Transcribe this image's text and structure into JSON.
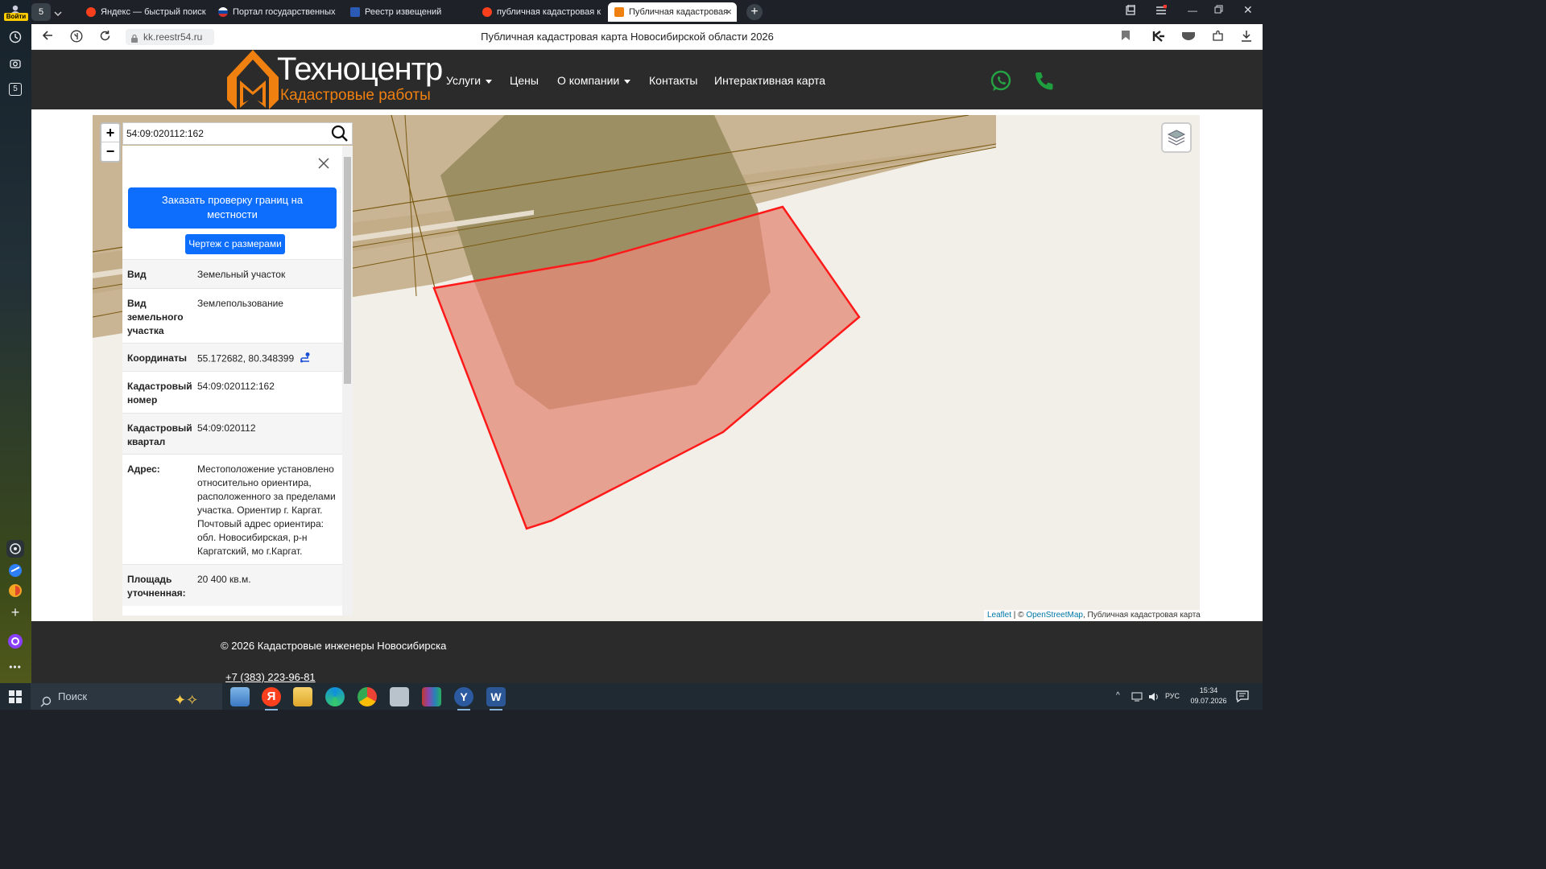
{
  "browser": {
    "login_label": "Войти",
    "tab_counter": "5",
    "tabs": [
      {
        "label": "Яндекс — быстрый поиск",
        "active": false
      },
      {
        "label": "Портал государственных",
        "active": false
      },
      {
        "label": "Реестр извещений",
        "active": false
      },
      {
        "label": "публичная кадастровая к",
        "active": false
      },
      {
        "label": "Публичная кадастровая",
        "active": true
      }
    ],
    "url": "kk.reestr54.ru",
    "page_title": "Публичная кадастровая карта Новосибирской области 2026"
  },
  "site": {
    "logo_title": "Техноцентр",
    "logo_subtitle": "Кадастровые работы",
    "nav": [
      {
        "label": "Услуги",
        "dropdown": true
      },
      {
        "label": "Цены",
        "dropdown": false
      },
      {
        "label": "О компании",
        "dropdown": true
      },
      {
        "label": "Контакты",
        "dropdown": false
      },
      {
        "label": "Интерактивная карта",
        "dropdown": false
      }
    ],
    "accent_color": "#f08010",
    "whatsapp_color": "#25a244",
    "phone_color": "#1e9e3e"
  },
  "map": {
    "search_value": "54:09:020112:162",
    "zoom_in": "+",
    "zoom_out": "−",
    "parcel_outline_color": "#ff1a1a",
    "parcel_fill_color": "#e48a78",
    "attribution": {
      "leaflet": "Leaflet",
      "separator": " | © ",
      "osm": "OpenStreetMap",
      "rest": ", Публичная кадастровая карта"
    }
  },
  "panel": {
    "close_icon": "close-icon",
    "order_button": "Заказать проверку границ на местности",
    "drawing_button": "Чертеж с размерами",
    "rows": [
      {
        "key": "Вид",
        "value": "Земельный участок"
      },
      {
        "key": "Вид земельного участка",
        "value": "Землепользование"
      },
      {
        "key": "Координаты",
        "value": "55.172682, 80.348399"
      },
      {
        "key": "Кадастровый номер",
        "value": "54:09:020112:162"
      },
      {
        "key": "Кадастровый квартал",
        "value": "54:09:020112"
      },
      {
        "key": "Адрес:",
        "value": "Местоположение установлено относительно ориентира, расположенного за пределами участка. Ориентир г. Каргат. Почтовый адрес ориентира: обл. Новосибирская, р-н Каргатский, мо г.Каргат."
      },
      {
        "key": "Площадь уточненная:",
        "value": "20 400 кв.м."
      }
    ]
  },
  "footer": {
    "copyright": "© 2026 Кадастровые инженеры Новосибирска",
    "phone": "+7 (383) 223-96-81"
  },
  "taskbar": {
    "search_label": "Поиск",
    "lang": "РУС",
    "time": "15:34",
    "date": "09.07.2026"
  }
}
